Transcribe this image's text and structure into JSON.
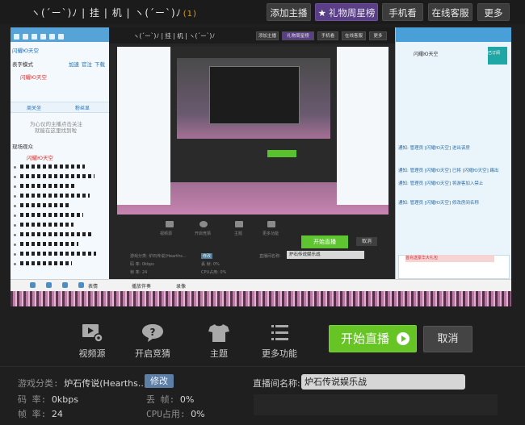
{
  "topbar": {
    "brand_text": "ヽ(´ー`)ﾉ | 挂 | 机 | ヽ(´ー`)ﾉ",
    "brand_count": "(1)",
    "buttons": [
      {
        "label": "添加主播"
      },
      {
        "label": "礼物周星榜",
        "icon": "star-icon"
      },
      {
        "label": "手机看"
      },
      {
        "label": "在线客服"
      },
      {
        "label": "更多"
      }
    ]
  },
  "preview": {
    "left_pane": {
      "title": "闪耀Ю天空",
      "mode_label": "表字模式",
      "mode_links": [
        "加速",
        "官注",
        "下载"
      ],
      "user_name": "闪耀Ю天空",
      "tabs": [
        "周关坐",
        "粉丝显"
      ],
      "hint_line1": "为心仪的主播点击关注",
      "hint_line2": "就能在这里找到啦",
      "viewers_label": "现场观众",
      "viewer_name": "闪耀Ю天空"
    },
    "nested": {
      "brand_text": "ヽ(´ー`)ﾉ | 挂 | 机 | ヽ(´ー`)ﾉ",
      "buttons": [
        "添加主播",
        "礼物周星榜",
        "手机看",
        "在线客服",
        "更多"
      ],
      "tools": [
        "视频源",
        "开启竞猜",
        "主题",
        "更多功能"
      ],
      "go_label": "开始直播",
      "cancel_label": "取消",
      "info_game": "游戏分类: 炉石传说(Hearths...",
      "info_modify": "修改",
      "info_rate": "码  率: 0kbps",
      "info_frame": "帧  率: 24",
      "info_drop": "丢  帧: 0%",
      "info_cpu": "CPU占用: 0%",
      "title_label": "直播间名称:",
      "title_value": "炉石传说娱乐战"
    },
    "right_pane": {
      "user_name": "闪耀Ю天空",
      "follow_label": "已订阅",
      "messages": [
        "通知: 管理员 [闪耀Ю天空] 进出该房",
        "通知: 管理员 [闪耀Ю天空] 已将 [闪耀Ю天空] 踢出",
        "通知: 管理员 [闪耀Ю天空] 将游客加入禁止",
        "通知: 管理员 [闪耀Ю天空] 修改房间名称"
      ],
      "banner": "首充送豪华大礼包"
    },
    "toolbar_items": [
      "表情",
      "播放伴奏",
      "录像"
    ]
  },
  "controls": {
    "tools": [
      {
        "label": "视频源",
        "icon": "video-source-icon"
      },
      {
        "label": "开启竞猜",
        "icon": "quiz-icon"
      },
      {
        "label": "主题",
        "icon": "theme-shirt-icon"
      },
      {
        "label": "更多功能",
        "icon": "more-list-icon"
      }
    ],
    "go_label": "开始直播",
    "cancel_label": "取消"
  },
  "info": {
    "game_label": "游戏分类:",
    "game_value": "炉石传说(Hearths...",
    "modify_label": "修改",
    "bitrate_label": "码    率:",
    "bitrate_value": "0kbps",
    "framerate_label": "帧    率:",
    "framerate_value": "24",
    "drop_label": "丢    帧:",
    "drop_value": "0%",
    "cpu_label": "CPU占用:",
    "cpu_value": "0%",
    "title_label": "直播间名称:",
    "title_value": "炉石传说娱乐战"
  }
}
